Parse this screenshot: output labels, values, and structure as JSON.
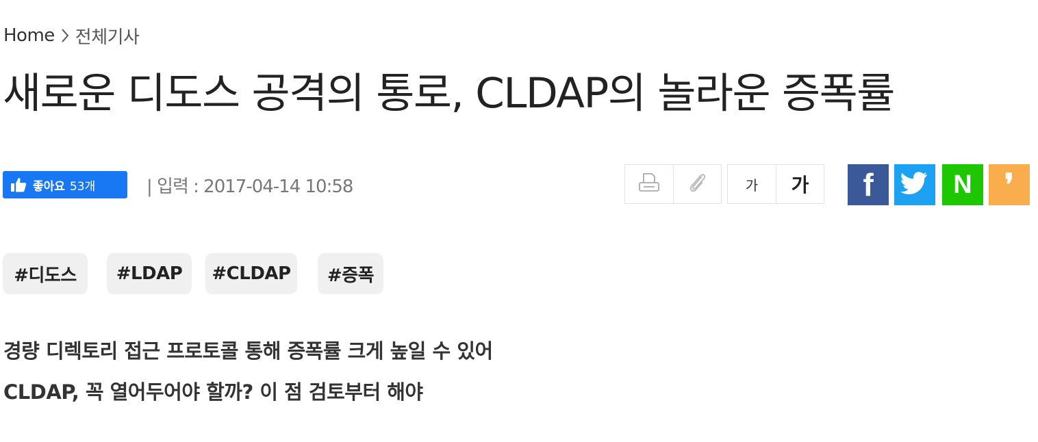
{
  "breadcrumb": {
    "home": "Home",
    "current": "전체기사"
  },
  "article": {
    "title": "새로운 디도스 공격의 통로, CLDAP의 놀라운 증폭률",
    "date": "| 입력 : 2017-04-14 10:58",
    "subtitles": [
      "경량 디렉토리 접근 프로토콜 통해 증폭률 크게 높일 수 있어",
      "CLDAP, 꼭 열어두어야 할까? 이 점 검토부터 해야"
    ]
  },
  "like": {
    "label": "좋아요",
    "count": "53개",
    "color": "#1877f2"
  },
  "tools": {
    "print_icon": "printer-icon",
    "clip_icon": "paperclip-icon",
    "font_small": "가",
    "font_large": "가"
  },
  "share": {
    "facebook": {
      "glyph": "f",
      "color": "#3b5998"
    },
    "twitter": {
      "icon": "twitter-bird-icon",
      "color": "#1da1f2"
    },
    "naver": {
      "glyph": "N",
      "color": "#1ec800"
    },
    "kakaostory": {
      "glyph": "❜",
      "color": "#f9ad4c"
    }
  },
  "tags": [
    "#디도스",
    "#LDAP",
    "#CLDAP",
    "#증폭"
  ]
}
